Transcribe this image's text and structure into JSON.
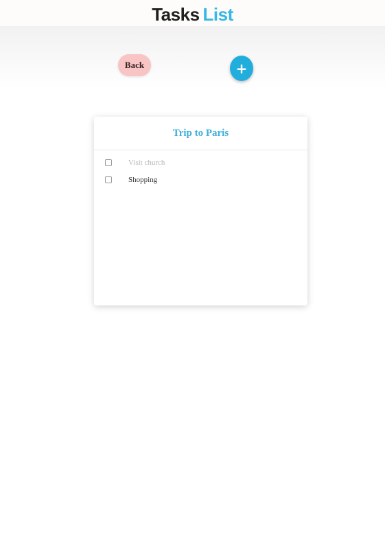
{
  "header": {
    "title_part1": "Tasks",
    "title_part2": "List"
  },
  "toolbar": {
    "back_label": "Back",
    "add_label": "+"
  },
  "list": {
    "title": "Trip to Paris",
    "tasks": [
      {
        "label": "Visit church",
        "done": true
      },
      {
        "label": "Shopping",
        "done": false
      }
    ]
  },
  "colors": {
    "accent": "#35b7e8",
    "back_button": "#f8c4c4",
    "add_button": "#22aedd"
  }
}
